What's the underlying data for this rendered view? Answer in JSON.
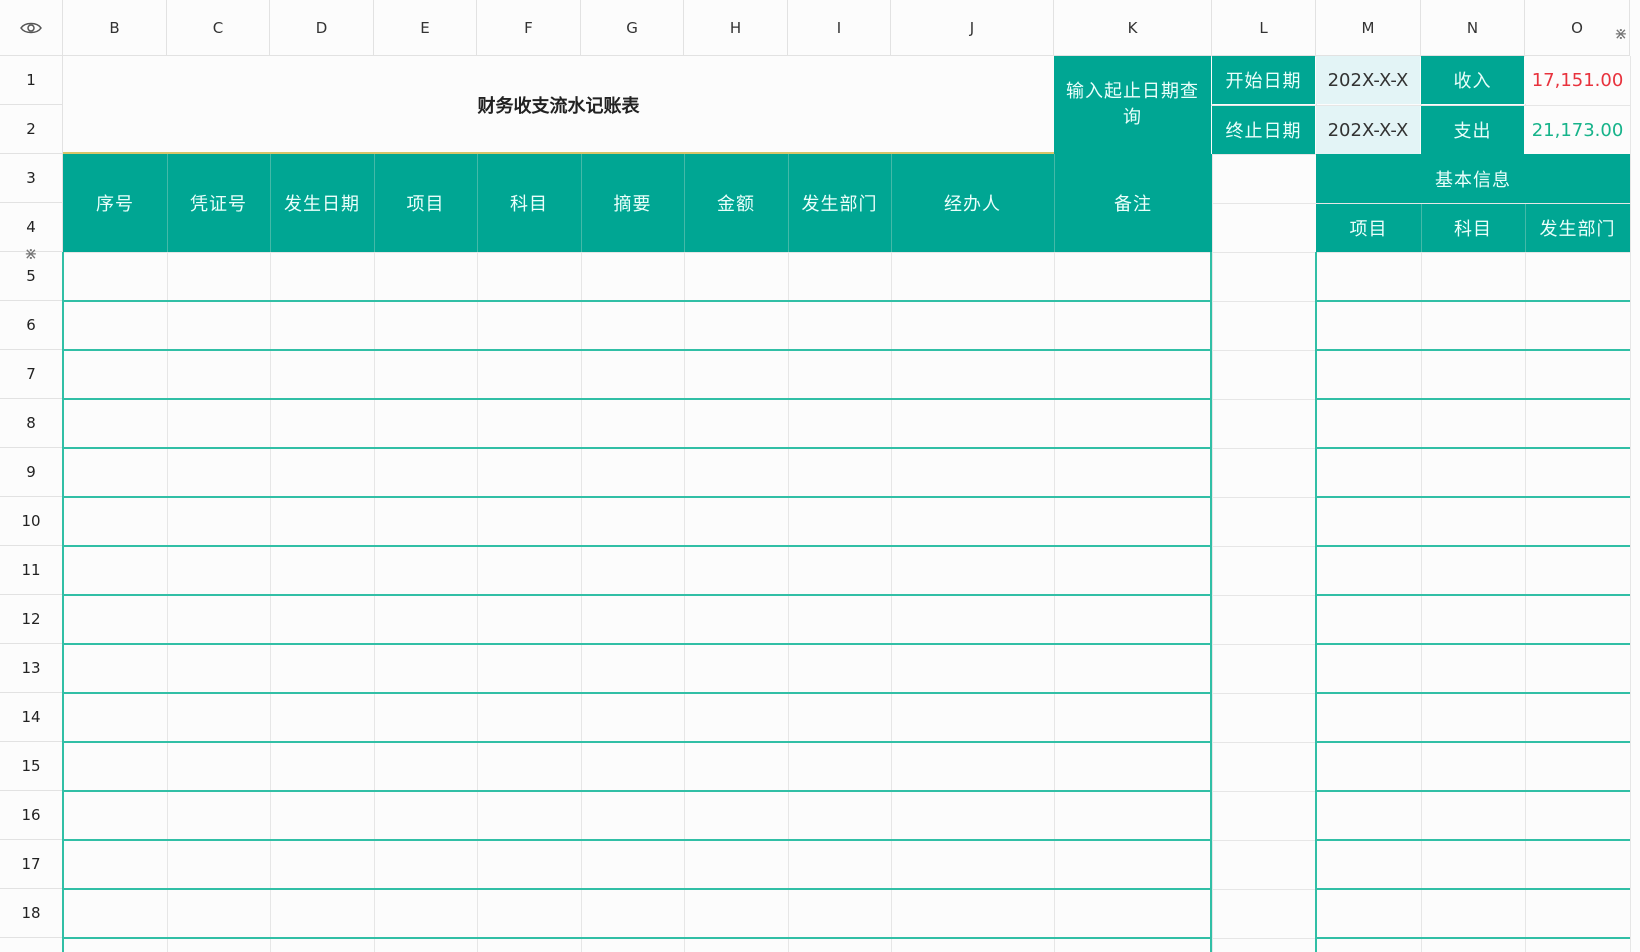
{
  "column_headers": [
    "B",
    "C",
    "D",
    "E",
    "F",
    "G",
    "H",
    "I",
    "J",
    "K",
    "L",
    "M",
    "N",
    "O"
  ],
  "row_headers": [
    "1",
    "2",
    "3",
    "4",
    "5",
    "6",
    "7",
    "8",
    "9",
    "10",
    "11",
    "12",
    "13",
    "14",
    "15",
    "16",
    "17",
    "18"
  ],
  "title": "财务收支流水记账表",
  "query": {
    "label": "输入起止日期查询",
    "start_label": "开始日期",
    "start_value": "202X-X-X",
    "end_label": "终止日期",
    "end_value": "202X-X-X",
    "income_label": "收入",
    "income_value": "17,151.00",
    "expense_label": "支出",
    "expense_value": "21,173.00"
  },
  "main_table_headers": [
    "序号",
    "凭证号",
    "发生日期",
    "项目",
    "科目",
    "摘要",
    "金额",
    "发生部门",
    "经办人",
    "备注"
  ],
  "basic_info": {
    "title": "基本信息",
    "headers": [
      "项目",
      "科目",
      "发生部门"
    ]
  },
  "colors": {
    "teal": "#00a693",
    "income": "#e8323d",
    "expense": "#16b38a",
    "date_bg": "#e3f4f6",
    "table_line": "#31bfa6"
  },
  "icons": {
    "corner": "eye-icon",
    "resize_handles": "resize-handle-icon"
  }
}
